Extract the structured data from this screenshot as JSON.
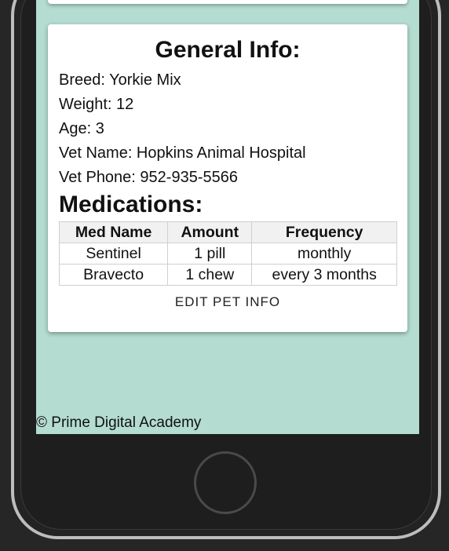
{
  "general_info": {
    "title": "General Info:",
    "breed": "Breed: Yorkie Mix",
    "weight": "Weight: 12",
    "age": "Age: 3",
    "vet_name": "Vet Name: Hopkins Animal Hospital",
    "vet_phone": "Vet Phone: 952-935-5566"
  },
  "medications": {
    "title": "Medications:",
    "headers": [
      "Med Name",
      "Amount",
      "Frequency"
    ],
    "rows": [
      [
        "Sentinel",
        "1 pill",
        "monthly"
      ],
      [
        "Bravecto",
        "1 chew",
        "every 3 months"
      ]
    ]
  },
  "edit_button_label": "EDIT PET INFO",
  "footer": "© Prime Digital Academy",
  "colors": {
    "screen_background": "#b4dcd0",
    "card_background": "#ffffff",
    "device_frame": "#262626"
  }
}
